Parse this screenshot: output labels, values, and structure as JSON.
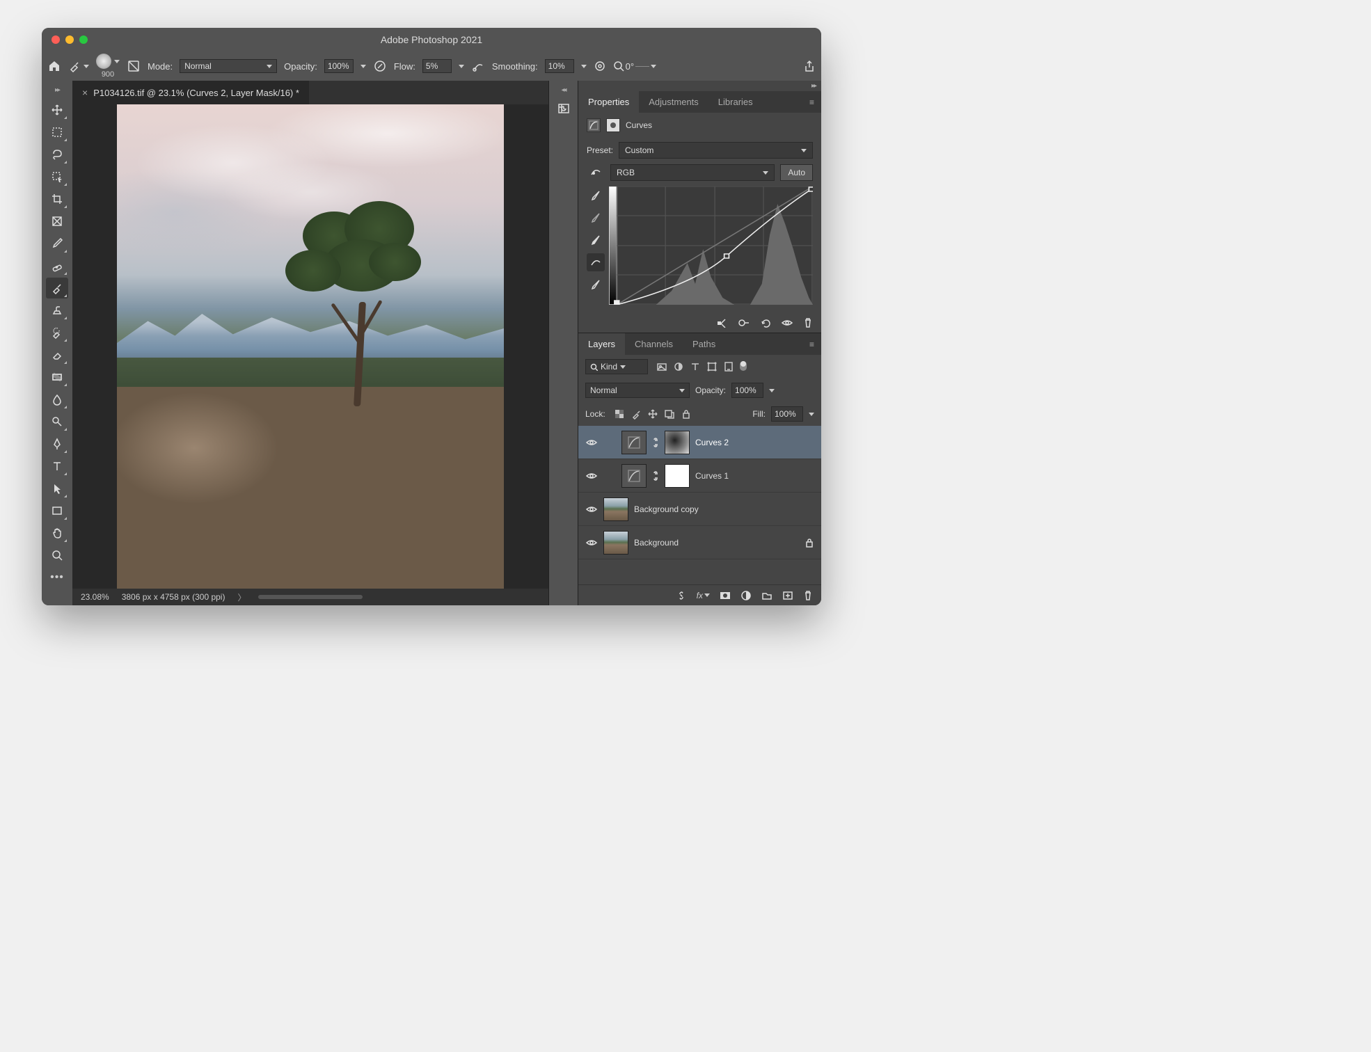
{
  "title": "Adobe Photoshop 2021",
  "options_bar": {
    "brush_size": "900",
    "mode_label": "Mode:",
    "mode_value": "Normal",
    "opacity_label": "Opacity:",
    "opacity_value": "100%",
    "flow_label": "Flow:",
    "flow_value": "5%",
    "smoothing_label": "Smoothing:",
    "smoothing_value": "10%",
    "angle_label": "0°"
  },
  "document": {
    "tab_title": "P1034126.tif @ 23.1% (Curves 2, Layer Mask/16) *",
    "zoom": "23.08%",
    "dimensions": "3806 px x 4758 px (300 ppi)"
  },
  "panels": {
    "top_tabs": [
      "Properties",
      "Adjustments",
      "Libraries"
    ],
    "properties": {
      "type_label": "Curves",
      "preset_label": "Preset:",
      "preset_value": "Custom",
      "channel_value": "RGB",
      "auto_label": "Auto"
    },
    "bottom_tabs": [
      "Layers",
      "Channels",
      "Paths"
    ],
    "layers": {
      "filter_value": "Kind",
      "blend_mode": "Normal",
      "opacity_label": "Opacity:",
      "opacity_value": "100%",
      "lock_label": "Lock:",
      "fill_label": "Fill:",
      "fill_value": "100%",
      "items": [
        {
          "name": "Curves 2",
          "type": "curves",
          "mask": "gradient",
          "selected": true,
          "visible": true
        },
        {
          "name": "Curves 1",
          "type": "curves",
          "mask": "white",
          "selected": false,
          "visible": true
        },
        {
          "name": "Background copy",
          "type": "image",
          "selected": false,
          "visible": true
        },
        {
          "name": "Background",
          "type": "image",
          "locked": true,
          "selected": false,
          "visible": true
        }
      ]
    }
  }
}
